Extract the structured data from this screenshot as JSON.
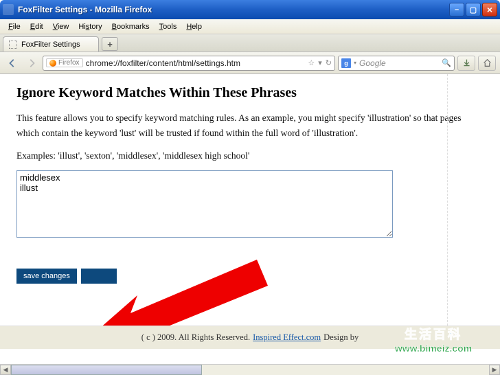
{
  "window": {
    "title": "FoxFilter Settings - Mozilla Firefox"
  },
  "menubar": {
    "file": "File",
    "edit": "Edit",
    "view": "View",
    "history": "History",
    "bookmarks": "Bookmarks",
    "tools": "Tools",
    "help": "Help"
  },
  "tabs": {
    "active_label": "FoxFilter Settings",
    "add_symbol": "+"
  },
  "nav": {
    "url_prefix_label": "Firefox",
    "url": "chrome://foxfilter/content/html/settings.htm",
    "search_engine": "g",
    "search_placeholder": "Google",
    "star": "☆",
    "dropdown": "▾",
    "reload": "↻"
  },
  "page": {
    "heading": "Ignore Keyword Matches Within These Phrases",
    "p1": "This feature allows you to specify keyword matching rules. As an example, you might specify 'illustration' so that pages which contain the keyword 'lust' will be trusted if found within the full word of 'illustration'.",
    "p2": "Examples: 'illust', 'sexton', 'middlesex', 'middlesex high school'",
    "textarea_value": "middlesex\nillust",
    "save_label": "save changes",
    "cancel_label": ""
  },
  "footer": {
    "copyright": "( c ) 2009. All Rights Reserved.",
    "link1_text": "Inspired Effect.com",
    "middle": "Design by"
  },
  "watermark": {
    "chars": "生活百科",
    "url": "www.bimeiz.com"
  }
}
